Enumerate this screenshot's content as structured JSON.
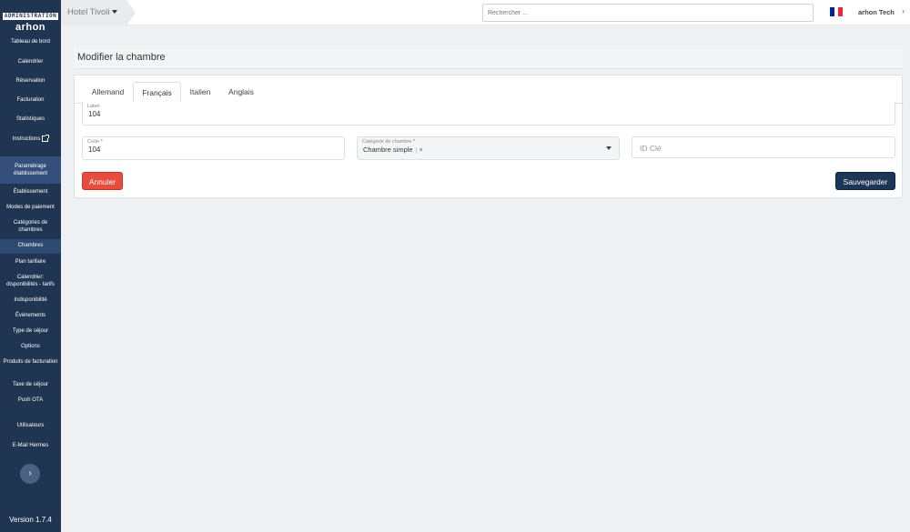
{
  "app": {
    "logo_top": "ADMINISTRATION",
    "logo_bottom": "arhon",
    "version": "Version 1.7.4"
  },
  "sidebar": {
    "items": [
      {
        "label": "Tableau de bord"
      },
      {
        "label": "Calendrier"
      },
      {
        "label": "Réservation"
      },
      {
        "label": "Facturation"
      },
      {
        "label": "Statistiques"
      },
      {
        "label": "Instructions"
      },
      {
        "label": "Paramétrage établissement"
      },
      {
        "label": "Établissement"
      },
      {
        "label": "Modes de paiement"
      },
      {
        "label": "Catégories de chambres"
      },
      {
        "label": "Chambres"
      },
      {
        "label": "Plan tarifaire"
      },
      {
        "label": "Calendrier: disponibilités - tarifs"
      },
      {
        "label": "Indisponibilité"
      },
      {
        "label": "Événements"
      },
      {
        "label": "Type de séjour"
      },
      {
        "label": "Options"
      },
      {
        "label": "Produits de facturation"
      },
      {
        "label": "Taxe de séjour"
      },
      {
        "label": "Push OTA"
      },
      {
        "label": "Utilisateurs"
      },
      {
        "label": "E-Mail Hermes"
      }
    ],
    "collapse_icon": "chevron-right-icon"
  },
  "topbar": {
    "hotel": "Hotel Tivoli",
    "search_placeholder": "Rechercher ...",
    "user": "arhon Tech",
    "flag_colors": [
      "#002395",
      "#ffffff",
      "#ed2939"
    ]
  },
  "page": {
    "title": "Modifier la chambre"
  },
  "tabs": [
    {
      "label": "Allemand"
    },
    {
      "label": "Français"
    },
    {
      "label": "Italien"
    },
    {
      "label": "Anglais"
    }
  ],
  "form": {
    "label_field": {
      "label": "Label",
      "value": "104"
    },
    "code_field": {
      "label": "Code",
      "required": "*",
      "value": "104"
    },
    "category_field": {
      "label": "Catégorie de chambre",
      "required": "*",
      "value": "Chambre simple",
      "clear": "×"
    },
    "key_field": {
      "placeholder": "ID Clé"
    }
  },
  "buttons": {
    "cancel": "Annuler",
    "save": "Sauvegarder"
  },
  "colors": {
    "sidebar_bg": "#1f3552",
    "cancel": "#e74c3c",
    "save": "#1d3557"
  }
}
